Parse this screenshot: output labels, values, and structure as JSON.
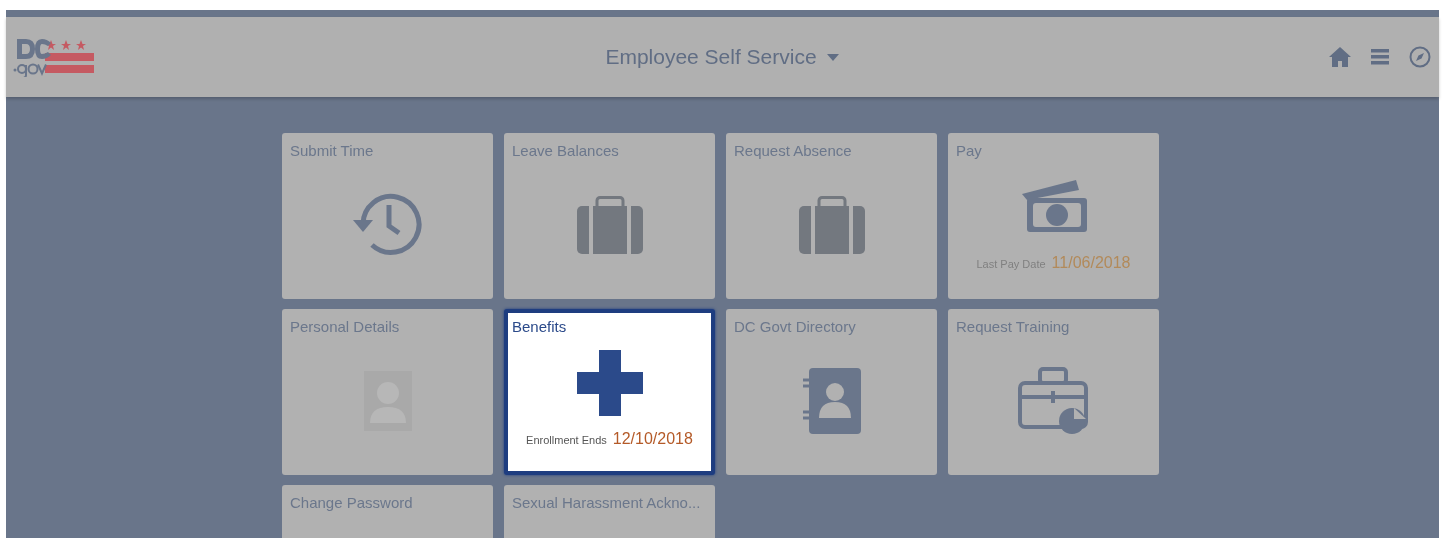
{
  "header": {
    "title": "Employee Self Service"
  },
  "tiles": [
    {
      "label": "Submit Time",
      "kind": "history",
      "selected": false
    },
    {
      "label": "Leave Balances",
      "kind": "briefcase",
      "selected": false
    },
    {
      "label": "Request Absence",
      "kind": "briefcase",
      "selected": false
    },
    {
      "label": "Pay",
      "kind": "money",
      "selected": false,
      "info_label": "Last Pay Date",
      "info_value": "11/06/2018"
    },
    {
      "label": "Personal Details",
      "kind": "photo",
      "selected": false
    },
    {
      "label": "Benefits",
      "kind": "plus",
      "selected": true,
      "info_label": "Enrollment Ends",
      "info_value": "12/10/2018"
    },
    {
      "label": "DC Govt Directory",
      "kind": "addressbook",
      "selected": false
    },
    {
      "label": "Request Training",
      "kind": "training",
      "selected": false
    },
    {
      "label": "Change Password",
      "kind": "blank",
      "selected": false
    },
    {
      "label": "Sexual Harassment Ackno...",
      "kind": "blank",
      "selected": false
    }
  ]
}
